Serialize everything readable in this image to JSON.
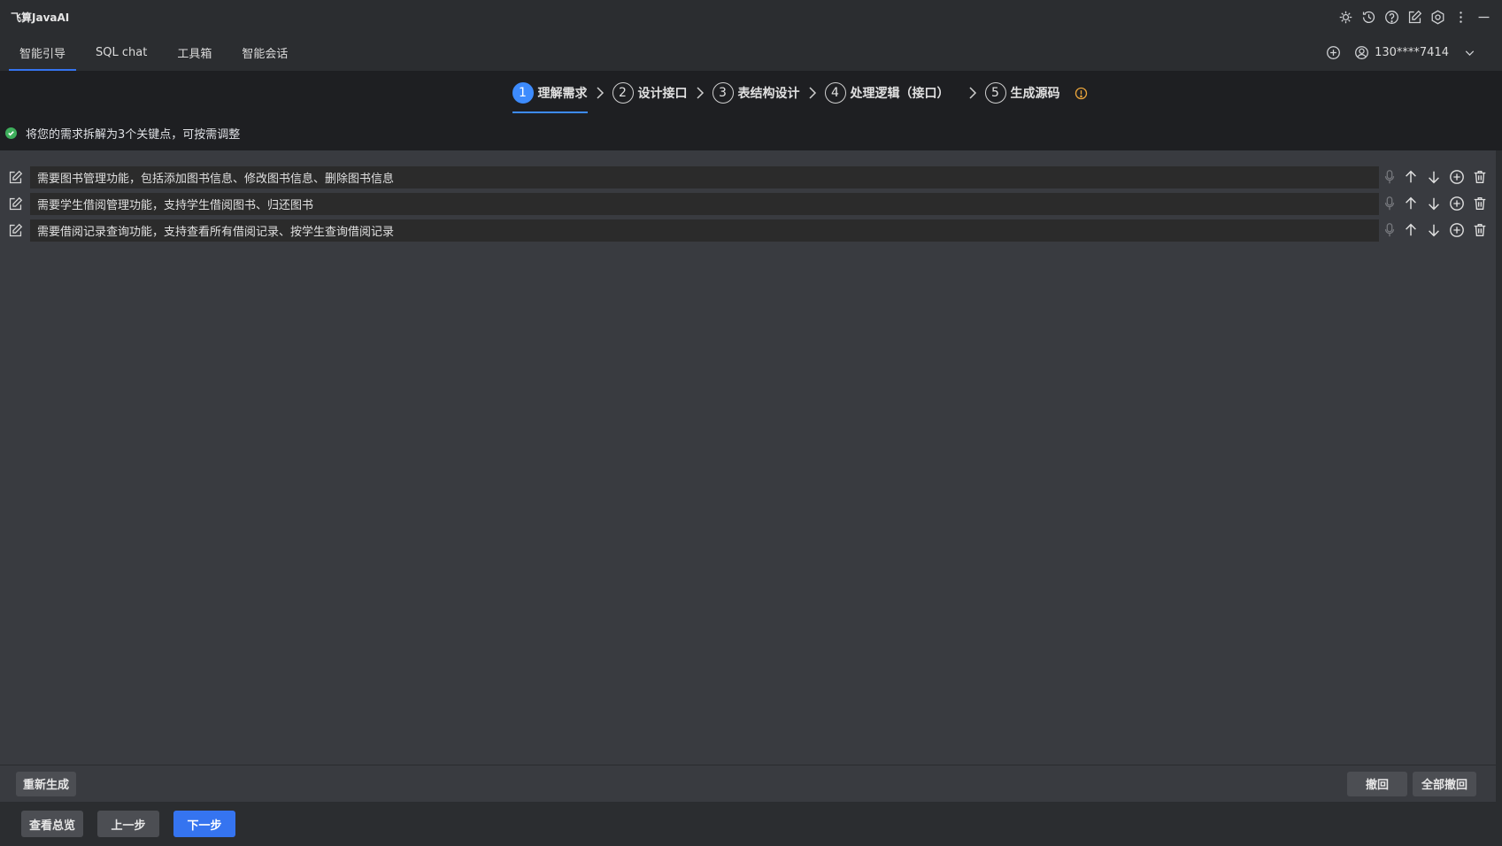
{
  "app": {
    "title": "飞算JavaAI"
  },
  "titlebar_icons": [
    "plugin-icon",
    "history-icon",
    "help-icon",
    "edit-icon",
    "settings-icon",
    "more-icon",
    "minimize-icon"
  ],
  "nav": {
    "tabs": [
      {
        "label": "智能引导",
        "active": true
      },
      {
        "label": "SQL chat",
        "active": false
      },
      {
        "label": "工具箱",
        "active": false
      },
      {
        "label": "智能会话",
        "active": false
      }
    ],
    "user": "130****7414"
  },
  "steps": [
    {
      "num": "1",
      "label": "理解需求",
      "active": true
    },
    {
      "num": "2",
      "label": "设计接口",
      "active": false
    },
    {
      "num": "3",
      "label": "表结构设计",
      "active": false
    },
    {
      "num": "4",
      "label": "处理逻辑（接口）",
      "active": false
    },
    {
      "num": "5",
      "label": "生成源码",
      "active": false
    }
  ],
  "notice": "将您的需求拆解为3个关键点，可按需调整",
  "requirements": [
    "需要图书管理功能，包括添加图书信息、修改图书信息、删除图书信息",
    "需要学生借阅管理功能，支持学生借阅图书、归还图书",
    "需要借阅记录查询功能，支持查看所有借阅记录、按学生查询借阅记录"
  ],
  "regen_bar": {
    "regenerate": "重新生成",
    "undo": "撤回",
    "undo_all": "全部撤回"
  },
  "footer": {
    "overview": "查看总览",
    "prev": "上一步",
    "next": "下一步"
  },
  "colors": {
    "accent": "#3574f0",
    "step_active": "#3d8bfd",
    "success": "#3eaf5c",
    "warning": "#e8a33b"
  }
}
